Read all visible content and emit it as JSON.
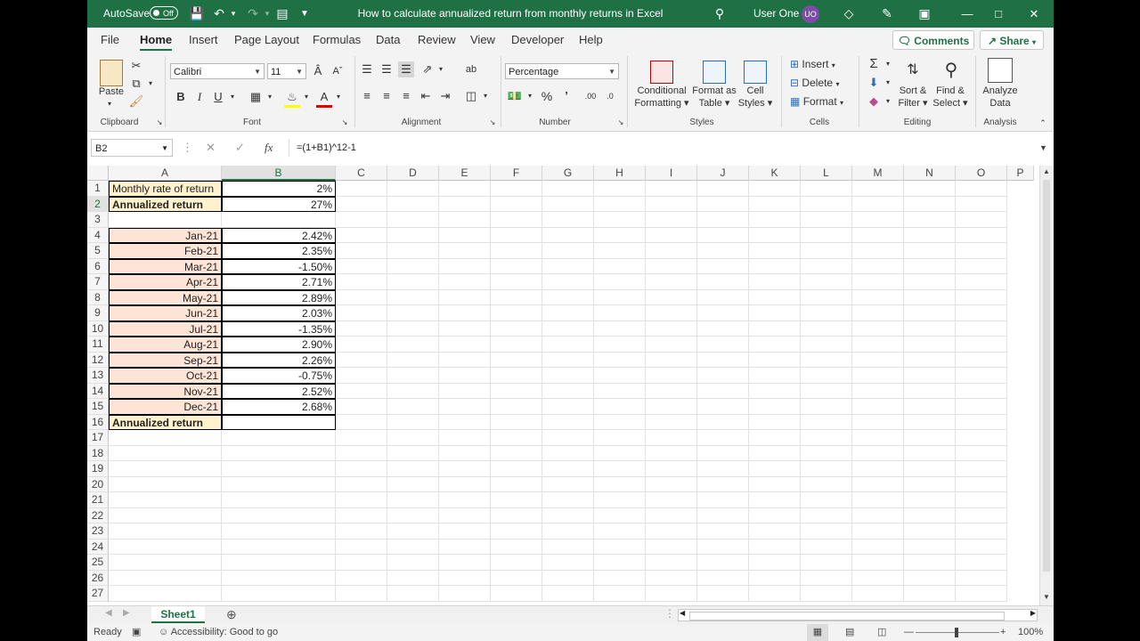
{
  "title_bar": {
    "autosave_label": "AutoSave",
    "autosave_state": "Off",
    "document_title": "How to calculate annualized return from monthly returns in Excel",
    "user_name": "User One",
    "user_initials": "UO"
  },
  "menu": {
    "tabs": [
      "File",
      "Home",
      "Insert",
      "Page Layout",
      "Formulas",
      "Data",
      "Review",
      "View",
      "Developer",
      "Help"
    ],
    "active_tab": "Home",
    "comments_label": "Comments",
    "share_label": "Share"
  },
  "ribbon": {
    "clipboard": {
      "paste_label": "Paste",
      "group_label": "Clipboard"
    },
    "font": {
      "font_name": "Calibri",
      "font_size": "11",
      "group_label": "Font"
    },
    "alignment": {
      "group_label": "Alignment"
    },
    "number": {
      "format": "Percentage",
      "group_label": "Number"
    },
    "styles": {
      "conditional_formatting": [
        "Conditional",
        "Formatting"
      ],
      "format_as_table": [
        "Format as",
        "Table"
      ],
      "cell_styles": [
        "Cell",
        "Styles"
      ],
      "group_label": "Styles"
    },
    "cells": {
      "insert_label": "Insert",
      "delete_label": "Delete",
      "format_label": "Format",
      "group_label": "Cells"
    },
    "editing": {
      "sort_filter": [
        "Sort &",
        "Filter"
      ],
      "find_select": [
        "Find &",
        "Select"
      ],
      "group_label": "Editing"
    },
    "analysis": {
      "analyze_data": [
        "Analyze",
        "Data"
      ],
      "group_label": "Analysis"
    }
  },
  "formula_bar": {
    "name_box": "B2",
    "formula": "=(1+B1)^12-1"
  },
  "grid": {
    "columns": [
      "A",
      "B",
      "C",
      "D",
      "E",
      "F",
      "G",
      "H",
      "I",
      "J",
      "K",
      "L",
      "M",
      "N",
      "O",
      "P"
    ],
    "rows": [
      "1",
      "2",
      "3",
      "4",
      "5",
      "6",
      "7",
      "8",
      "9",
      "10",
      "11",
      "12",
      "13",
      "14",
      "15",
      "16",
      "17",
      "18",
      "19",
      "20",
      "21",
      "22",
      "23",
      "24",
      "25",
      "26",
      "27"
    ],
    "selected_cell": "B2",
    "cells": {
      "A1": "Monthly rate of return",
      "B1": "2%",
      "A2": "Annualized return",
      "B2": "27%",
      "A4": "Jan-21",
      "B4": "2.42%",
      "A5": "Feb-21",
      "B5": "2.35%",
      "A6": "Mar-21",
      "B6": "-1.50%",
      "A7": "Apr-21",
      "B7": "2.71%",
      "A8": "May-21",
      "B8": "2.89%",
      "A9": "Jun-21",
      "B9": "2.03%",
      "A10": "Jul-21",
      "B10": "-1.35%",
      "A11": "Aug-21",
      "B11": "2.90%",
      "A12": "Sep-21",
      "B12": "2.26%",
      "A13": "Oct-21",
      "B13": "-0.75%",
      "A14": "Nov-21",
      "B14": "2.52%",
      "A15": "Dec-21",
      "B15": "2.68%",
      "A16": "Annualized return",
      "B16": ""
    }
  },
  "sheets": {
    "tabs": [
      "Sheet1"
    ],
    "active": "Sheet1"
  },
  "status_bar": {
    "mode": "Ready",
    "accessibility": "Accessibility: Good to go",
    "zoom": "100%"
  },
  "colors": {
    "excel_green": "#1f7145",
    "label_yellow": "#fff2cc",
    "label_peach": "#fce4d6"
  }
}
